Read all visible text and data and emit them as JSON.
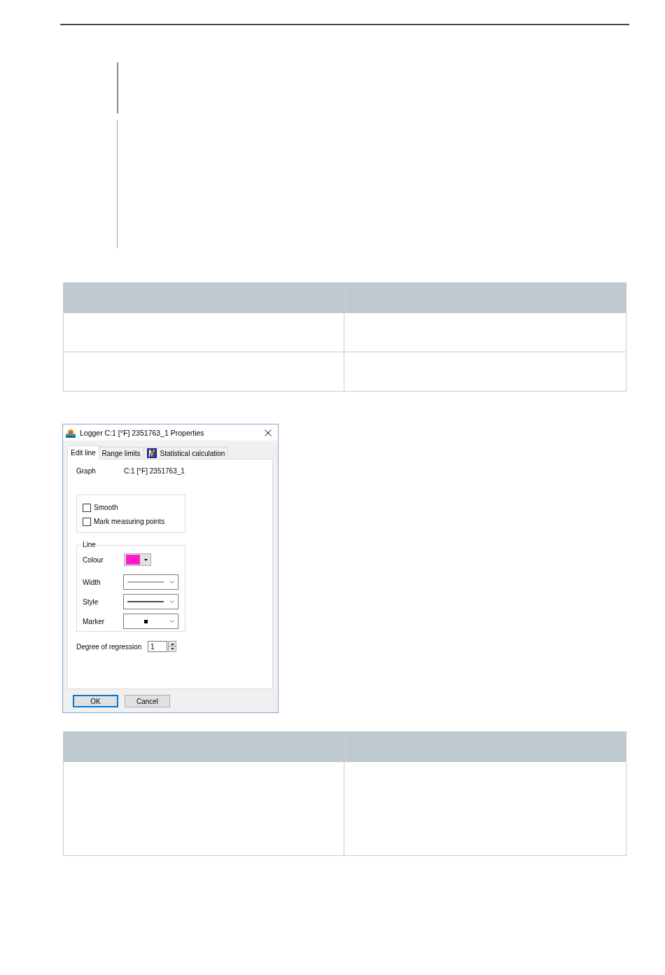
{
  "dialog": {
    "title": "Logger C:1 [°F] 2351763_1 Properties",
    "tabs": [
      {
        "label": "Edit line",
        "selected": true,
        "kind": "text"
      },
      {
        "label": "Range limits",
        "selected": false,
        "kind": "text"
      },
      {
        "label": "Statistical calculation",
        "selected": false,
        "kind": "icon"
      }
    ],
    "graph": {
      "label": "Graph",
      "value": "C:1 [°F] 2351763_1"
    },
    "options": [
      {
        "label": "Smooth",
        "checked": false
      },
      {
        "label": "Mark measuring points",
        "checked": false
      }
    ],
    "line_group": {
      "title": "Line",
      "rows": [
        {
          "kind": "color",
          "label": "Colour",
          "color": "#ff1acb"
        },
        {
          "kind": "width",
          "label": "Width"
        },
        {
          "kind": "style",
          "label": "Style"
        },
        {
          "kind": "marker",
          "label": "Marker"
        }
      ]
    },
    "regression": {
      "label": "Degree of regression",
      "value": "1"
    },
    "buttons": [
      {
        "label": "OK",
        "default": true
      },
      {
        "label": "Cancel",
        "default": false
      }
    ]
  }
}
